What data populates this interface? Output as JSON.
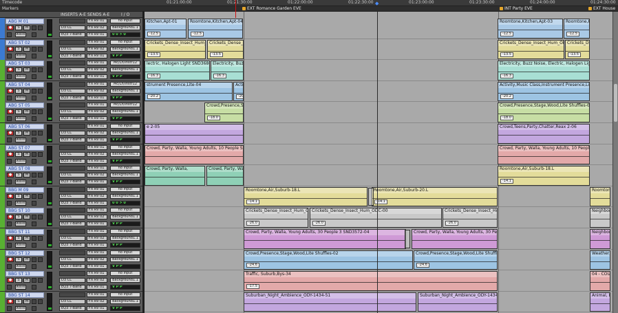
{
  "rulers": {
    "timecode_label": "Timecode",
    "markers_label": "Markers",
    "timecode_ticks": [
      "01:21:00:00",
      "01:21:30:00",
      "01:22:00:00",
      "01:22:30:00",
      "01:23:00:00",
      "01:23:30:00",
      "01:24:00:00",
      "01:24:30:00"
    ],
    "marker_items": [
      "EXT Romance Garden EVE",
      "INT Party EVE",
      "EXT House"
    ]
  },
  "column_headers": {
    "inserts": "INSERTS A-E",
    "sends": "SENDS A-E",
    "io": "I / O"
  },
  "accent_colors": {
    "ruler": "#3a3a3a",
    "playhead": "#4a8cff",
    "record": "#c33030"
  },
  "tracks": [
    {
      "name": "ABG M 01",
      "bar": "#3c7ad1",
      "ins1": "D3 CL",
      "ins2": "EQ3 7-Band",
      "send1": "FX RV 01",
      "send2": "FX RV 02",
      "in": "no input",
      "out": "Background1.1",
      "vol": "0 0 > 0"
    },
    {
      "name": "ABG ST 02",
      "bar": "#3c7ad1",
      "ins1": "D3 CL",
      "ins2": "EQ3 7-Band",
      "send1": "FX RV 01",
      "send2": "FX RV 02",
      "in": "no input",
      "out": "Background1.1",
      "vol": "V P P"
    },
    {
      "name": "ABG ST 03",
      "bar": "#58b032",
      "ins1": "D3 CL",
      "ins2": "EQ3 7-Band",
      "send1": "FX RV 01",
      "send2": "FX RV 02",
      "in": "Mc/Ln/Instr12",
      "out": "Background1.1",
      "vol": "V P P"
    },
    {
      "name": "ABG ST 04",
      "bar": "#58b032",
      "ins1": "D3 CL",
      "ins2": "EQ3 7-Band",
      "send1": "FX RV 01",
      "send2": "FX RV 02",
      "in": "Mc/Ln/Instr12",
      "out": "Background1.1",
      "vol": "V P P"
    },
    {
      "name": "ABG ST 05",
      "bar": "#58b032",
      "ins1": "D3 CL",
      "ins2": "EQ3 7-Band",
      "send1": "FX RV 01",
      "send2": "FX RV 02",
      "in": "Mc/Ln/Instr12",
      "out": "Background1.1",
      "vol": "V P P"
    },
    {
      "name": "ABG ST 06",
      "bar": "#58b032",
      "ins1": "D3 CL",
      "ins2": "EQ3 7-Band",
      "send1": "FX RV 01",
      "send2": "FX RV 02",
      "in": "no input",
      "out": "Background1.1",
      "vol": "V P P"
    },
    {
      "name": "ABG ST 07",
      "bar": "#58b032",
      "ins1": "D3 CL",
      "ins2": "EQ3 7-Band",
      "send1": "FX RV 01",
      "send2": "FX RV 02",
      "in": "no input",
      "out": "Background1.1",
      "vol": "V P P"
    },
    {
      "name": "ABG ST 08",
      "bar": "#58b032",
      "ins1": "D3 CL",
      "ins2": "EQ3 7-Band",
      "send1": "FX RV 01",
      "send2": "FX RV 02",
      "in": "no input",
      "out": "Background1.1",
      "vol": "V P P"
    },
    {
      "name": "BBG M 09",
      "bar": "#58b032",
      "ins1": "D3 CL",
      "ins2": "EQ3 7-Band",
      "send1": "FX RV 01",
      "send2": "FX RV 02",
      "in": "no input",
      "out": "Background1.1",
      "vol": "0 0 > 0"
    },
    {
      "name": "BBG ST 10",
      "bar": "#58b032",
      "ins1": "D3 CL",
      "ins2": "EQ3 7-Band",
      "send1": "FX RV 01",
      "send2": "FX RV 02",
      "in": "no input",
      "out": "Background1.1",
      "vol": "V P P"
    },
    {
      "name": "BBG ST 11",
      "bar": "#58b032",
      "ins1": "D3 CL",
      "ins2": "EQ3 7-Band",
      "send1": "FX RV 01",
      "send2": "FX RV 02",
      "in": "no input",
      "out": "Background1.1",
      "vol": "V P P"
    },
    {
      "name": "BBG ST 12",
      "bar": "#58b032",
      "ins1": "D3 CL",
      "ins2": "EQ3 7-Band",
      "send1": "FX RV 01",
      "send2": "FX RV 02",
      "in": "no input",
      "out": "Background1.1",
      "vol": "V P P"
    },
    {
      "name": "BBG ST 13",
      "bar": "#58b032",
      "ins1": "D3 CL",
      "ins2": "EQ3 7-Band",
      "send1": "FX RV 01",
      "send2": "FX RV 02",
      "in": "no input",
      "out": "Background1.1",
      "vol": "V P P"
    },
    {
      "name": "BBG ST 14",
      "bar": "#58b032",
      "ins1": "D3 CL",
      "ins2": "EQ3 7-Band",
      "send1": "FX RV 01",
      "send2": "FX RV 02",
      "in": "no input",
      "out": "Background1.1",
      "vol": "V P P"
    }
  ],
  "strip_buttons": {
    "wave": "wave",
    "mute": "M",
    "solo": "S"
  },
  "clips": [
    {
      "name": "Kitchen,Apt-01",
      "gain": "-12.5",
      "color": "#a9c9e6"
    },
    {
      "name": "Roomtone,Kitchen,Apt-04",
      "gain": "-12.5",
      "color": "#a9c9e6"
    },
    {
      "name": "Roomtone,Kitchen,Apt-03",
      "gain": "-12.5",
      "color": "#a9c9e6"
    },
    {
      "name": "Roomtone,Kitchen,Apt",
      "gain": "-12.5",
      "color": "#a9c9e6"
    },
    {
      "name": "Crickets_Dense_Insect_Hum_ODC-00",
      "gain": "-13.5",
      "color": "#e3dc9a"
    },
    {
      "name": "Crickets_Dense_Insect",
      "gain": "-13.5",
      "color": "#e3dc9a"
    },
    {
      "name": "Crickets_Dense_Insect_Hum_ODC-001",
      "gain": "-13.5",
      "color": "#e3dc9a"
    },
    {
      "name": "Crickets_De",
      "gain": "-13.5",
      "color": "#e3dc9a"
    },
    {
      "name": "lectric, Halogen Light SND36809-05",
      "gain": "-16.3",
      "color": "#a8dfd4"
    },
    {
      "name": "Electricity, Buzz Noi",
      "gain": "-16.3",
      "color": "#a8dfd4"
    },
    {
      "name": "Electricity, Buzz Noise, Electric, Halogen Light SND36",
      "gain": "-16.3",
      "color": "#a8dfd4"
    },
    {
      "name": "strument Presence,Lite-04",
      "gain": "-20.2",
      "color": "#9dc4e3"
    },
    {
      "name": "Activity,Mus",
      "gain": "-20.2",
      "color": "#9dc4e3"
    },
    {
      "name": "Activity,Music Class,Instrument Presence,Lite-06",
      "gain": "-20.2",
      "color": "#9dc4e3"
    },
    {
      "name": "Crowd,Presence,Stag",
      "gain": "-18.0",
      "color": "#c7dea4"
    },
    {
      "name": "Crowd,Presence,Stage,Wood,Lite Shuffles-07",
      "gain": "-18.0",
      "color": "#c7dea4"
    },
    {
      "name": "e 2-05",
      "gain": "",
      "color": "#c3a7df"
    },
    {
      "name": "Crowd,Teens,Party,Chatter,Reax 2-06",
      "gain": "",
      "color": "#c3a7df"
    },
    {
      "name": "Crowd, Party, Walla, Young Adults, 10 People SND357",
      "gain": "",
      "color": "#e3a9a9"
    },
    {
      "name": "Crowd, Party, Walla, Young Adults, 10 People SND357",
      "gain": "",
      "color": "#e3a9a9"
    },
    {
      "name": "Crowd, Party, Walla,",
      "gain": "",
      "color": "#8fd0b6"
    },
    {
      "name": "Crowd, Party, Walla, Young Adults, 30 People 3 SND35",
      "gain": "",
      "color": "#8fd0b6"
    },
    {
      "name": "Roomtone,Air,Suburb-18.L",
      "gain": "-14.1",
      "color": "#e3dc9a"
    },
    {
      "name": "Roomtone,Air,Suburb-20.L",
      "gain": "-14.1",
      "color": "#e3dc9a"
    },
    {
      "name": "Roomtone",
      "gain": "",
      "color": "#e3dc9a"
    },
    {
      "name": "Crickets_Dense_Insect_Hum_ODC-00",
      "gain": "-26.0",
      "color": "#c9c9c9"
    },
    {
      "name": "Crickets_Dense_Insect_Hum_ODC-00",
      "gain": "-26.0",
      "color": "#c9c9c9"
    },
    {
      "name": "Crickets_Dense_Insect_Hum_ODC",
      "gain": "-26.0",
      "color": "#c9c9c9"
    },
    {
      "name": "Neighborho",
      "gain": "",
      "color": "#c9c9c9"
    },
    {
      "name": "Crowd, Party, Walla, Young Adults, 30 People 3 SND3572-04",
      "gain": "",
      "color": "#cf9ad6"
    },
    {
      "name": "Crowd, Party, Walla, Young Adults, 30 People 3 S",
      "gain": "",
      "color": "#cf9ad6"
    },
    {
      "name": "Neighborho",
      "gain": "",
      "color": "#cf9ad6"
    },
    {
      "name": "Crowd,Presence,Stage,Wood,Lite Shuffles-02",
      "gain": "-24.6",
      "color": "#9dc4e3"
    },
    {
      "name": "Crowd,Presence,Stage,Wood,Lite Shuffles-06",
      "gain": "-24.6",
      "color": "#9dc4e3"
    },
    {
      "name": "Weather, Win",
      "gain": "",
      "color": "#9dc4e3"
    },
    {
      "name": "Traffic, Suburb,Bys-34",
      "gain": "-17.5",
      "color": "#e3a9a9"
    },
    {
      "name": "04 - COUNTR",
      "gain": "",
      "color": "#e3a9a9"
    },
    {
      "name": "Suburban_Night_Ambience_ODY-1434-51",
      "gain": "",
      "color": "#c3a7df"
    },
    {
      "name": "Suburban_Night_Ambience_ODY-1434-50",
      "gain": "",
      "color": "#c3a7df"
    },
    {
      "name": "Animal, Bird",
      "gain": "",
      "color": "#c3a7df"
    }
  ]
}
